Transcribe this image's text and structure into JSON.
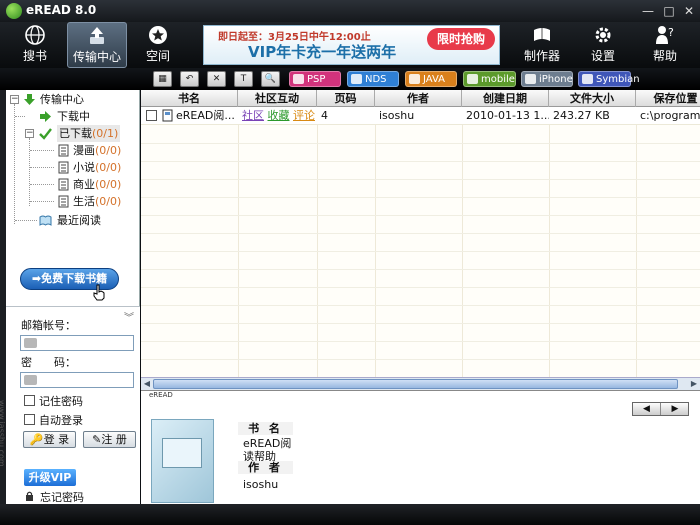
{
  "window": {
    "title": "eREAD 8.0",
    "controls": [
      "—",
      "□",
      "✕"
    ]
  },
  "toolbar": {
    "buttons": [
      {
        "label": "搜书",
        "icon": "globe-icon"
      },
      {
        "label": "传输中心",
        "icon": "transfer-icon",
        "active": true
      },
      {
        "label": "空间",
        "icon": "star-icon"
      },
      {
        "label": "制作器",
        "icon": "book-maker-icon"
      },
      {
        "label": "设置",
        "icon": "gear-icon"
      },
      {
        "label": "帮助",
        "icon": "help-icon"
      }
    ]
  },
  "banner": {
    "top_text": "即日起至：3月25日中午12:00止",
    "main_text": "VIP年卡充一年送两年",
    "badge": "限时抢购"
  },
  "filters": {
    "tools": [
      "▦",
      "↶",
      "✕",
      "T",
      "🔍"
    ],
    "devices": [
      {
        "label": "PSP",
        "color": "#d2337c"
      },
      {
        "label": "NDS",
        "color": "#2f7fd4"
      },
      {
        "label": "JAVA",
        "color": "#d9801c"
      },
      {
        "label": "mobile",
        "color": "#5c9a2b"
      },
      {
        "label": "iPhone",
        "color": "#6d7d8f"
      },
      {
        "label": "Symbian",
        "color": "#3f56b8"
      }
    ]
  },
  "tree": {
    "root": "传输中心",
    "downloading": "下载中",
    "downloaded": "已下载",
    "downloaded_count": "(0/1)",
    "categories": [
      {
        "label": "漫画",
        "count": "(0/0)"
      },
      {
        "label": "小说",
        "count": "(0/0)"
      },
      {
        "label": "商业",
        "count": "(0/0)"
      },
      {
        "label": "生活",
        "count": "(0/0)"
      }
    ],
    "recent": "最近阅读"
  },
  "free_download_button": "免费下载书籍",
  "login": {
    "email_label": "邮箱帐号：",
    "email_value": "",
    "password_label": "密　　码：",
    "password_value": "",
    "remember_password": "记住密码",
    "auto_login": "自动登录",
    "login_button": "登 录",
    "register_button": "注 册",
    "upgrade_vip": "升级VIP",
    "forgot_password": "忘记密码"
  },
  "vertical_watermark": "www.iasshu.com",
  "table": {
    "columns": [
      "书名",
      "社区互动",
      "页码",
      "作者",
      "创建日期",
      "文件大小",
      "保存位置"
    ],
    "rows": [
      {
        "checked": false,
        "title": "eREAD阅...",
        "interactions": [
          {
            "label": "社区",
            "color": "#7a43b6"
          },
          {
            "label": "收藏",
            "color": "#2c9a2c"
          },
          {
            "label": "评论",
            "color": "#d98a13"
          }
        ],
        "pages": "4",
        "author": "isoshu",
        "created": "2010-01-13 1...",
        "size": "243.27 KB",
        "location": "c:\\program fi"
      }
    ]
  },
  "preview": {
    "section_label": "eREAD",
    "nav_prev": "◀",
    "nav_next": "▶",
    "title_label": "书 名",
    "title_value_line1": "eREAD阅",
    "title_value_line2": "读帮助",
    "author_label": "作 者",
    "author_value": "isoshu"
  }
}
